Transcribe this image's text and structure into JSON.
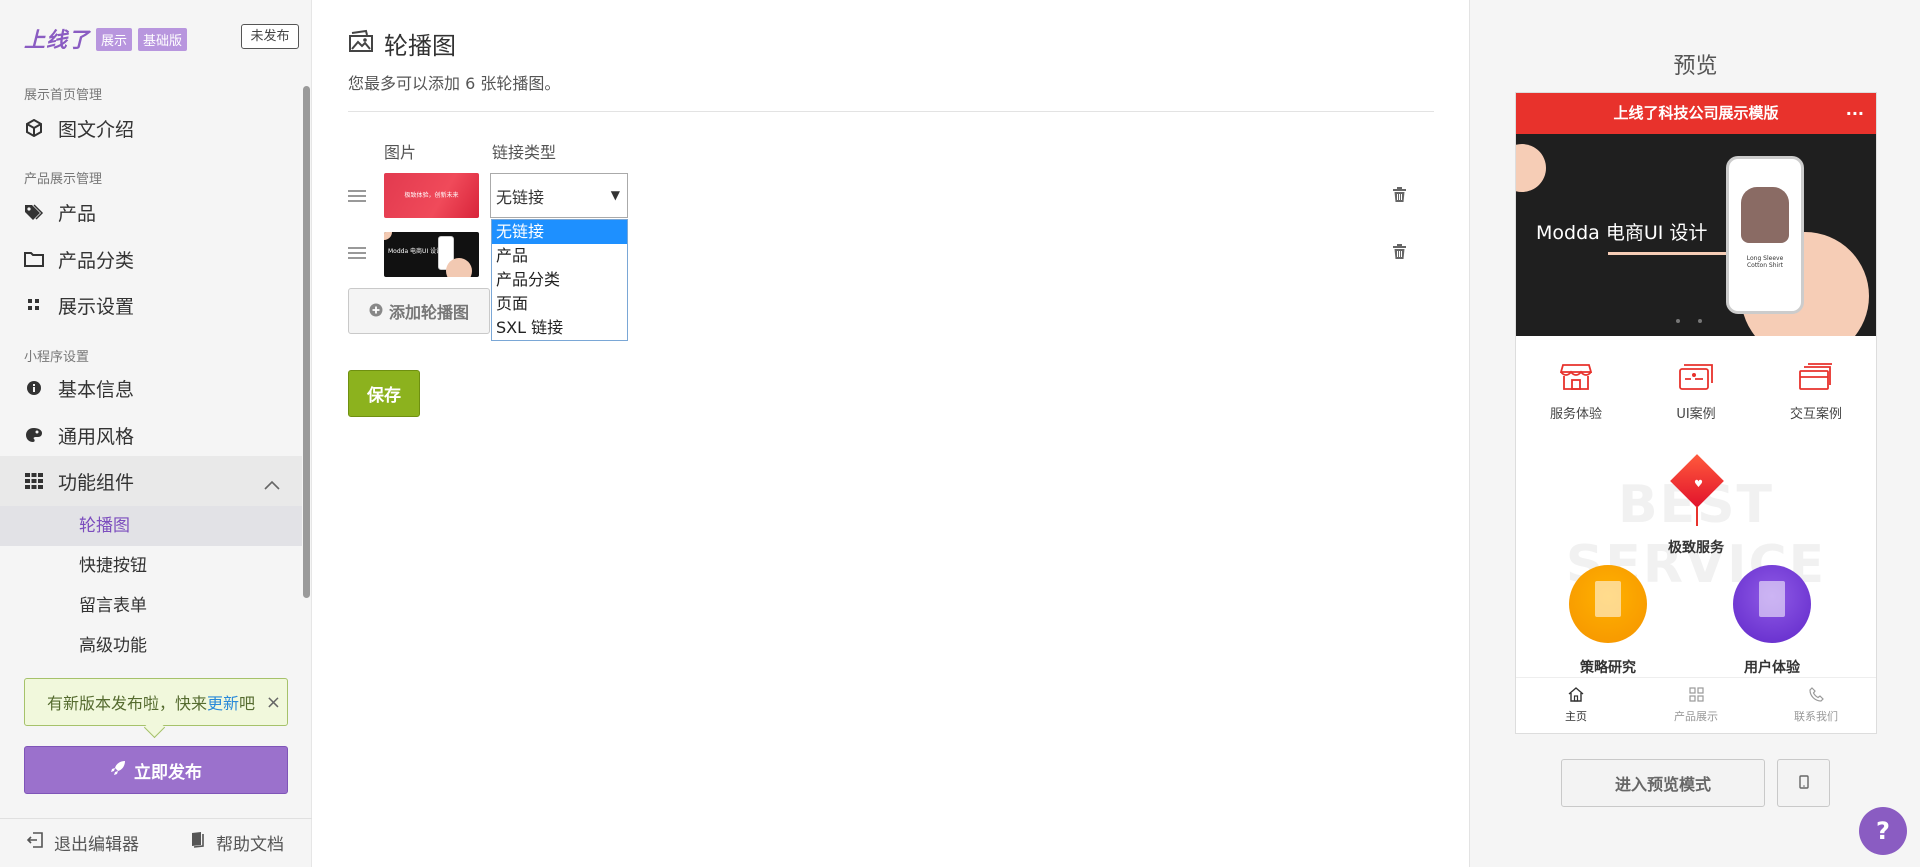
{
  "sidebar": {
    "brand": {
      "logo": "上线了",
      "tag1": "展示",
      "tag2": "基础版"
    },
    "unpublished_label": "未发布",
    "sections": [
      {
        "title": "展示首页管理",
        "items": [
          {
            "label": "图文介绍",
            "icon": "cube-icon"
          }
        ]
      },
      {
        "title": "产品展示管理",
        "items": [
          {
            "label": "产品",
            "icon": "tags-icon"
          },
          {
            "label": "产品分类",
            "icon": "folder-icon"
          },
          {
            "label": "展示设置",
            "icon": "grid-small-icon"
          }
        ]
      },
      {
        "title": "小程序设置",
        "items": [
          {
            "label": "基本信息",
            "icon": "info-icon"
          },
          {
            "label": "通用风格",
            "icon": "palette-icon"
          }
        ]
      }
    ],
    "group": {
      "label": "功能组件",
      "icon": "apps-icon",
      "expanded": true,
      "items": [
        "轮播图",
        "快捷按钮",
        "留言表单",
        "高级功能"
      ],
      "active_index": 0
    },
    "notice": {
      "text_before": "有新版本发布啦，快来",
      "link": "更新",
      "text_after": "吧",
      "close": "×"
    },
    "publish_label": "立即发布",
    "footer": {
      "exit_label": "退出编辑器",
      "help_label": "帮助文档"
    }
  },
  "main": {
    "title": "轮播图",
    "description": "您最多可以添加 6 张轮播图。",
    "columns": {
      "image": "图片",
      "link_type": "链接类型"
    },
    "rows": [
      {
        "thumb_text": "极致体验，创新未来",
        "link_type": "无链接"
      },
      {
        "thumb_text": "Modda 电商UI 设计",
        "link_type": ""
      }
    ],
    "dropdown": {
      "options": [
        "无链接",
        "产品",
        "产品分类",
        "页面",
        "SXL 链接"
      ],
      "selected_index": 0
    },
    "add_label": "添加轮播图",
    "save_label": "保存"
  },
  "preview": {
    "title": "预览",
    "phone": {
      "header_title": "上线了科技公司展示模版",
      "header_more": "···",
      "banner": {
        "text": "Modda 电商UI 设计",
        "product_text_1": "Long Sleeve",
        "product_text_2": "Cotton Shirt"
      },
      "icons": [
        {
          "label": "服务体验",
          "icon": "store-icon"
        },
        {
          "label": "UI案例",
          "icon": "card-icon"
        },
        {
          "label": "交互案例",
          "icon": "cards-icon"
        }
      ],
      "watermark": "BEST SERVICE",
      "service_title": "极致服务",
      "bubbles": [
        {
          "label": "策略研究"
        },
        {
          "label": "用户体验"
        }
      ],
      "tabs": [
        {
          "label": "主页",
          "icon": "home-icon"
        },
        {
          "label": "产品展示",
          "icon": "grid-icon"
        },
        {
          "label": "联系我们",
          "icon": "phone-icon"
        }
      ]
    },
    "preview_mode_label": "进入预览模式",
    "help_label": "?"
  },
  "colors": {
    "accent": "#9b71cc",
    "header_red": "#e8322c",
    "save_green": "#8cb21e"
  }
}
